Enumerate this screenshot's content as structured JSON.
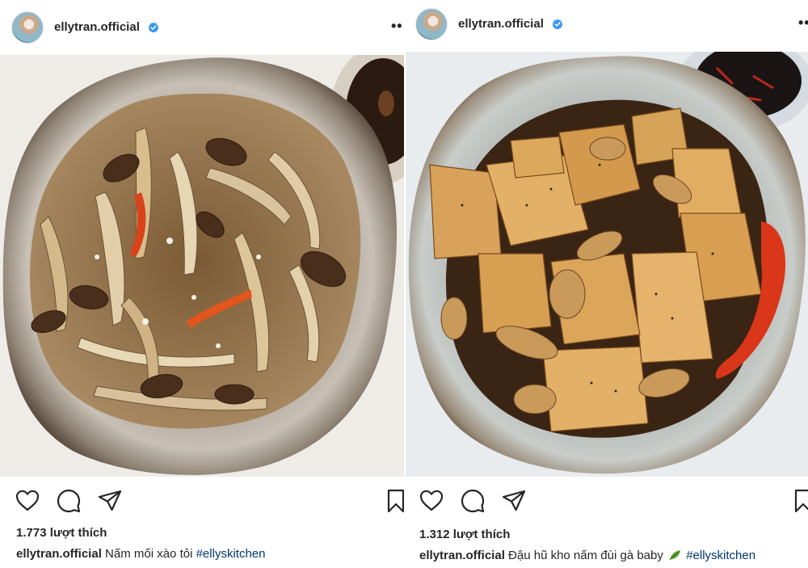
{
  "posts": [
    {
      "username": "ellytran.official",
      "more_label": "••",
      "likes": "1.773 lượt thích",
      "caption": {
        "user": "ellytran.official",
        "text": " Nấm mối xào tỏi ",
        "hashtag": "#ellyskitchen"
      },
      "photo": {
        "alt": "Nấm mối xào tỏi"
      }
    },
    {
      "username": "ellytran.official",
      "more_label": "••",
      "likes": "1.312 lượt thích",
      "caption": {
        "user": "ellytran.official",
        "text": " Đậu hũ kho nấm đùi gà baby ",
        "emoji": "leaf",
        "hashtag": "#ellyskitchen"
      },
      "photo": {
        "alt": "Đậu hũ kho nấm đùi gà baby"
      }
    }
  ],
  "icons": {
    "like": "heart-icon",
    "comment": "comment-icon",
    "share": "paper-plane-icon",
    "save": "bookmark-icon",
    "verified": "verified-badge-icon"
  },
  "colors": {
    "text": "#262626",
    "verified": "#3897f0",
    "hashtag": "#00376b"
  }
}
